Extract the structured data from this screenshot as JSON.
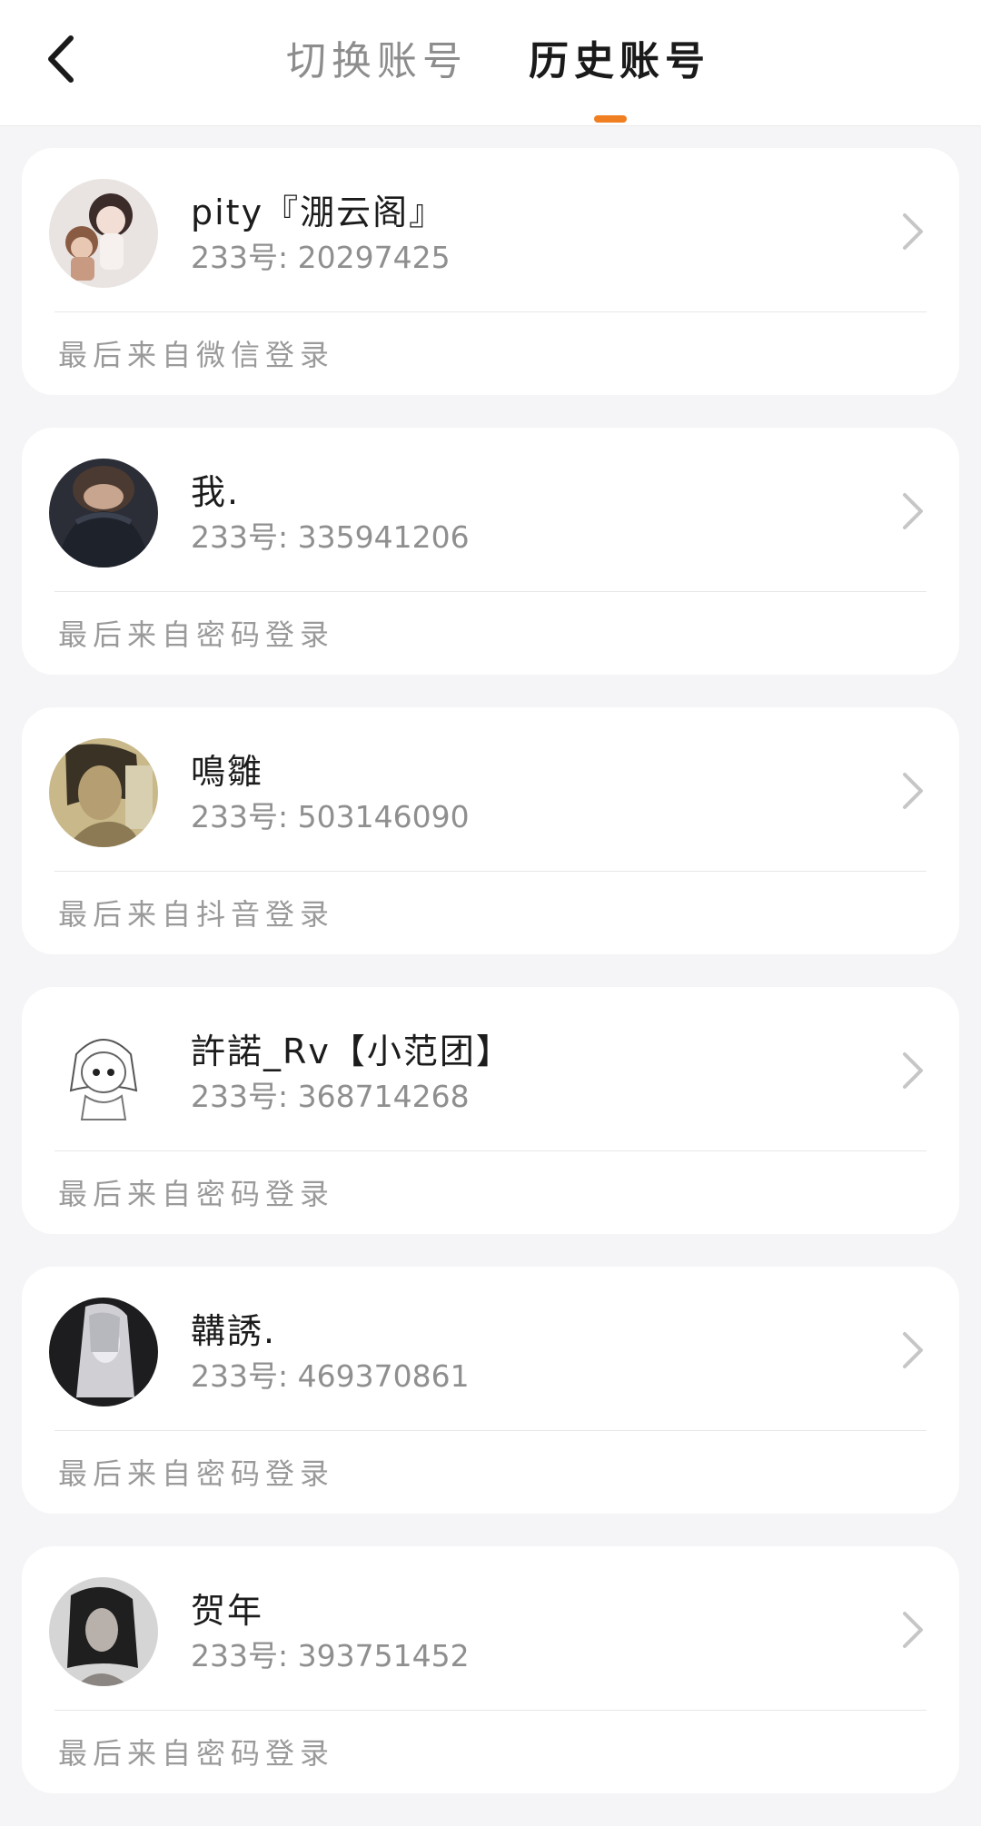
{
  "header": {
    "back_icon": "chevron-left-icon",
    "tabs": [
      {
        "label": "切换账号",
        "active": false
      },
      {
        "label": "历史账号",
        "active": true
      }
    ],
    "accent_color": "#f07f21"
  },
  "accounts": [
    {
      "name": "pity『淜云阁』",
      "id_prefix": "233号:",
      "id": "20297425",
      "login_source": "最后来自微信登录"
    },
    {
      "name": "我.",
      "id_prefix": "233号:",
      "id": "335941206",
      "login_source": "最后来自密码登录"
    },
    {
      "name": "鳴雛",
      "id_prefix": "233号:",
      "id": "503146090",
      "login_source": "最后来自抖音登录"
    },
    {
      "name": "許諾_Rv【小范团】",
      "id_prefix": "233号:",
      "id": "368714268",
      "login_source": "最后来自密码登录"
    },
    {
      "name": "韝誘.",
      "id_prefix": "233号:",
      "id": "469370861",
      "login_source": "最后来自密码登录"
    },
    {
      "name": "贺年",
      "id_prefix": "233号:",
      "id": "393751452",
      "login_source": "最后来自密码登录"
    }
  ]
}
